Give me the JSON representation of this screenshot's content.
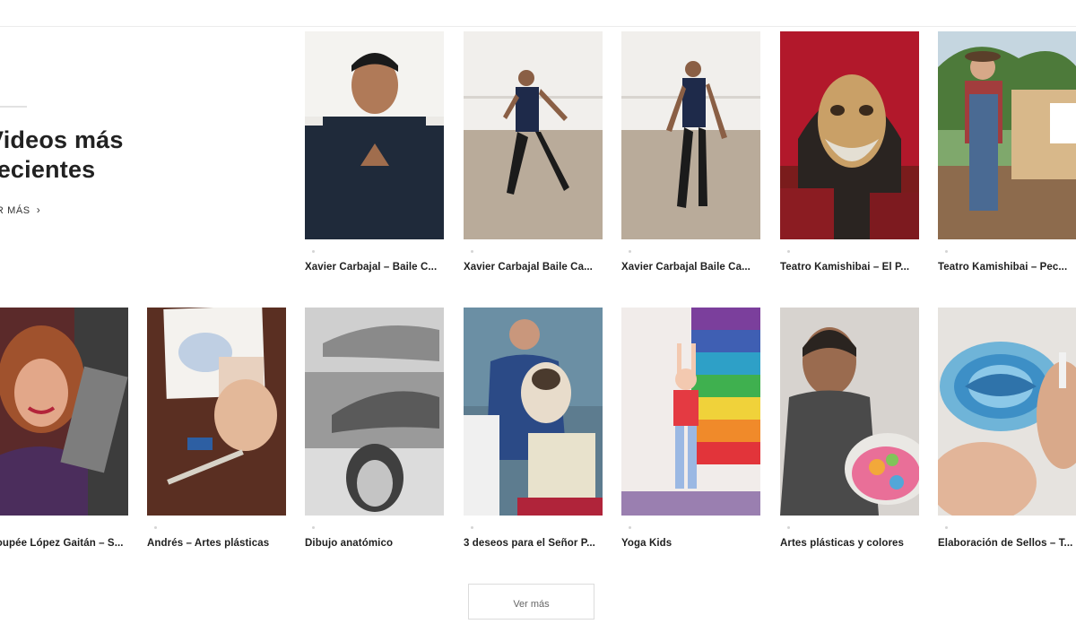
{
  "section": {
    "title": "Videos más\nrecientes",
    "see_more_label": "VER MÁS",
    "see_more_icon": "chevron-right-icon"
  },
  "videos": [
    {
      "title": "Xavier Carbajal – Baile C..."
    },
    {
      "title": "Xavier Carbajal Baile Ca..."
    },
    {
      "title": "Xavier Carbajal Baile Ca..."
    },
    {
      "title": "Teatro Kamishibai – El P..."
    },
    {
      "title": "Teatro Kamishibai – Pec..."
    },
    {
      "title": "Poupée López Gaitán – S..."
    },
    {
      "title": "Andrés – Artes plásticas"
    },
    {
      "title": "Dibujo anatómico"
    },
    {
      "title": "3 deseos para el Señor P..."
    },
    {
      "title": "Yoga Kids"
    },
    {
      "title": "Artes plásticas y colores"
    },
    {
      "title": "Elaboración de Sellos – T..."
    }
  ],
  "load_more_label": "Ver más"
}
